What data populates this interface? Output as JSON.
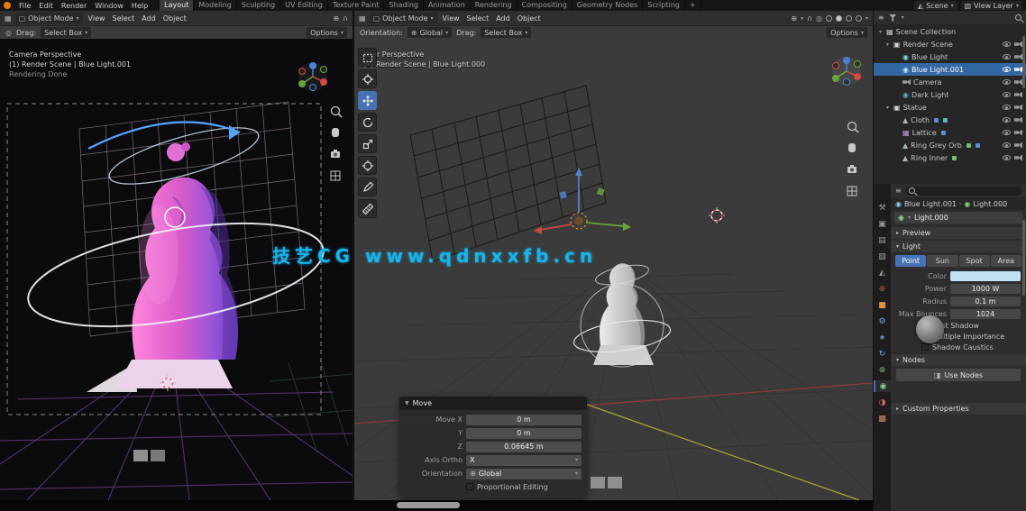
{
  "icons": {
    "chevron": "▾",
    "tri_right": "▸",
    "tri_down": "▼",
    "globe": "⊕",
    "magnet": "∩",
    "proportional": "◎",
    "editor_grid": "▦",
    "mode_cube": "▢",
    "scene_collection": "▦",
    "collection": "▣",
    "light": "◉",
    "mesh": "▲",
    "lattice": "▦",
    "list": "≡",
    "tool": "⚒",
    "render": "▣",
    "output": "▤",
    "viewlayer": "▧",
    "scene": "◭",
    "world": "⊕",
    "object": "■",
    "modifier": "⚙",
    "particles": "∗",
    "physics": "↻",
    "constraint": "⊗",
    "data_light": "◉",
    "material": "◑",
    "texture": "▩",
    "nodes": "◨",
    "breadcrumb_sep": "›"
  },
  "topbar": {
    "menus": [
      "File",
      "Edit",
      "Render",
      "Window",
      "Help"
    ],
    "workspaces": [
      "Layout",
      "Modeling",
      "Sculpting",
      "UV Editing",
      "Texture Paint",
      "Shading",
      "Animation",
      "Rendering",
      "Compositing",
      "Geometry Nodes",
      "Scripting",
      "+"
    ],
    "active_workspace": "Layout",
    "scene_label": "Scene",
    "view_layer_label": "View Layer"
  },
  "left_vp": {
    "mode": "Object Mode",
    "menus": [
      "View",
      "Select",
      "Add",
      "Object"
    ],
    "tool": {
      "drag_label": "Drag:",
      "drag_value": "Select Box",
      "options": "Options"
    },
    "overlay": {
      "l1": "Camera Perspective",
      "l2": "(1) Render Scene | Blue Light.001",
      "l3": "Rendering Done"
    }
  },
  "center_vp": {
    "mode": "Object Mode",
    "menus": [
      "View",
      "Select",
      "Add",
      "Object"
    ],
    "tool": {
      "orientation_label": "Orientation:",
      "orientation_value": "Global",
      "drag_label": "Drag:",
      "drag_value": "Select Box",
      "options": "Options"
    },
    "overlay": {
      "l1": "User Perspective",
      "l2": "(1) Render Scene | Blue Light.000"
    }
  },
  "move_panel": {
    "title": "Move",
    "x_label": "Move X",
    "x_value": "0 m",
    "y_label": "Y",
    "y_value": "0 m",
    "z_label": "Z",
    "z_value": "0.06645 m",
    "axis_label": "Axis Ortho",
    "axis_value": "X",
    "orient_label": "Orientation",
    "orient_value": "Global",
    "prop_label": "Proportional Editing"
  },
  "outliner": {
    "rows": [
      {
        "label": "Scene Collection"
      },
      {
        "label": "Render Scene"
      },
      {
        "label": "Blue Light"
      },
      {
        "label": "Blue Light.001"
      },
      {
        "label": "Camera"
      },
      {
        "label": "Dark Light"
      },
      {
        "label": "Statue"
      },
      {
        "label": "Cloth"
      },
      {
        "label": "Lattice"
      },
      {
        "label": "Ring Grey Orb"
      },
      {
        "label": "Ring Inner"
      }
    ]
  },
  "properties": {
    "breadcrumb_a": "Blue Light.001",
    "breadcrumb_b": "Light.000",
    "datablock": "Light.000",
    "preview_section": "Preview",
    "light_section": "Light",
    "types": [
      "Point",
      "Sun",
      "Spot",
      "Area"
    ],
    "active_type": "Point",
    "color_label": "Color",
    "color_value": "#c2e2f3",
    "power_label": "Power",
    "power_value": "1000 W",
    "radius_label": "Radius",
    "radius_value": "0.1 m",
    "bounces_label": "Max Bounces",
    "bounces_value": "1024",
    "cb1": "Cast Shadow",
    "cb2": "Multiple Importance",
    "cb3": "Shadow Caustics",
    "nodes_section": "Nodes",
    "use_nodes": "Use Nodes",
    "custom_section": "Custom Properties"
  },
  "watermark": "技艺CG www.qdnxxfb.cn",
  "colors": {
    "accent": "#4772b3",
    "selection": "#3367a2",
    "watermark": "#18b4ea"
  }
}
